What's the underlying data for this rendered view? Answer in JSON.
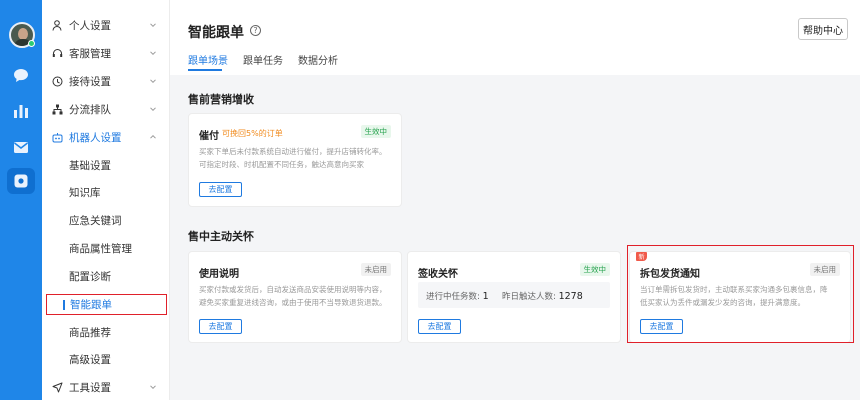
{
  "app": {
    "title": "智能跟单",
    "help_label": "帮助中心"
  },
  "tabs": [
    {
      "label": "跟单场景",
      "active": true
    },
    {
      "label": "跟单任务",
      "active": false
    },
    {
      "label": "数据分析",
      "active": false
    }
  ],
  "rail": {
    "icons": [
      "avatar",
      "chat-icon",
      "chart-icon",
      "mail-icon",
      "settings-icon"
    ],
    "active": "settings-icon",
    "accent": "#1f86e8"
  },
  "menu": {
    "items": [
      {
        "label": "个人设置",
        "icon": "person-icon",
        "expandable": true
      },
      {
        "label": "客服管理",
        "icon": "headset-icon",
        "expandable": true
      },
      {
        "label": "接待设置",
        "icon": "reception-icon",
        "expandable": true
      },
      {
        "label": "分流排队",
        "icon": "routing-icon",
        "expandable": true
      },
      {
        "label": "机器人设置",
        "icon": "robot-icon",
        "expandable": true,
        "expanded": true
      },
      {
        "label": "基础设置"
      },
      {
        "label": "知识库"
      },
      {
        "label": "应急关键词"
      },
      {
        "label": "商品属性管理"
      },
      {
        "label": "配置诊断"
      },
      {
        "label": "智能跟单",
        "active": true
      },
      {
        "label": "商品推荐"
      },
      {
        "label": "高级设置"
      },
      {
        "label": "工具设置",
        "icon": "send-icon",
        "expandable": true
      }
    ]
  },
  "sections": [
    {
      "title": "售前营销增收",
      "cards": [
        {
          "title": "催付",
          "subtitle": "可挽回5%的订单",
          "status": "生效中",
          "desc": [
            "买家下单后未付款系统自动进行催付，提升店铺转化率。",
            "可指定时段、时机配置不同任务，触达高意向买家"
          ],
          "button": "去配置"
        }
      ]
    },
    {
      "title": "售中主动关怀",
      "cards": [
        {
          "title": "使用说明",
          "status": "未启用",
          "desc": [
            "买家付款或发货后，自动发送商品安装使用说明等内容，",
            "避免买家重复进线咨询，或由于使用不当导致退货退款。"
          ],
          "button": "去配置"
        },
        {
          "title": "签收关怀",
          "status": "生效中",
          "stats": {
            "running_label": "进行中任务数:",
            "running_value": "1",
            "yesterday_label": "昨日触达人数:",
            "yesterday_value": "1278"
          },
          "button": "去配置"
        },
        {
          "title": "拆包发货通知",
          "status": "未启用",
          "tag": "新",
          "desc": [
            "当订单需拆包发货时，主动联系买家沟通多包裹信息，降",
            "低买家认为丢件或漏发少发的咨询，提升满意度。"
          ],
          "button": "去配置"
        }
      ]
    }
  ],
  "colors": {
    "primary": "#1f7ae0",
    "highlight": "#e0202a",
    "success": "#22a04a",
    "warning": "#f08a1c"
  }
}
